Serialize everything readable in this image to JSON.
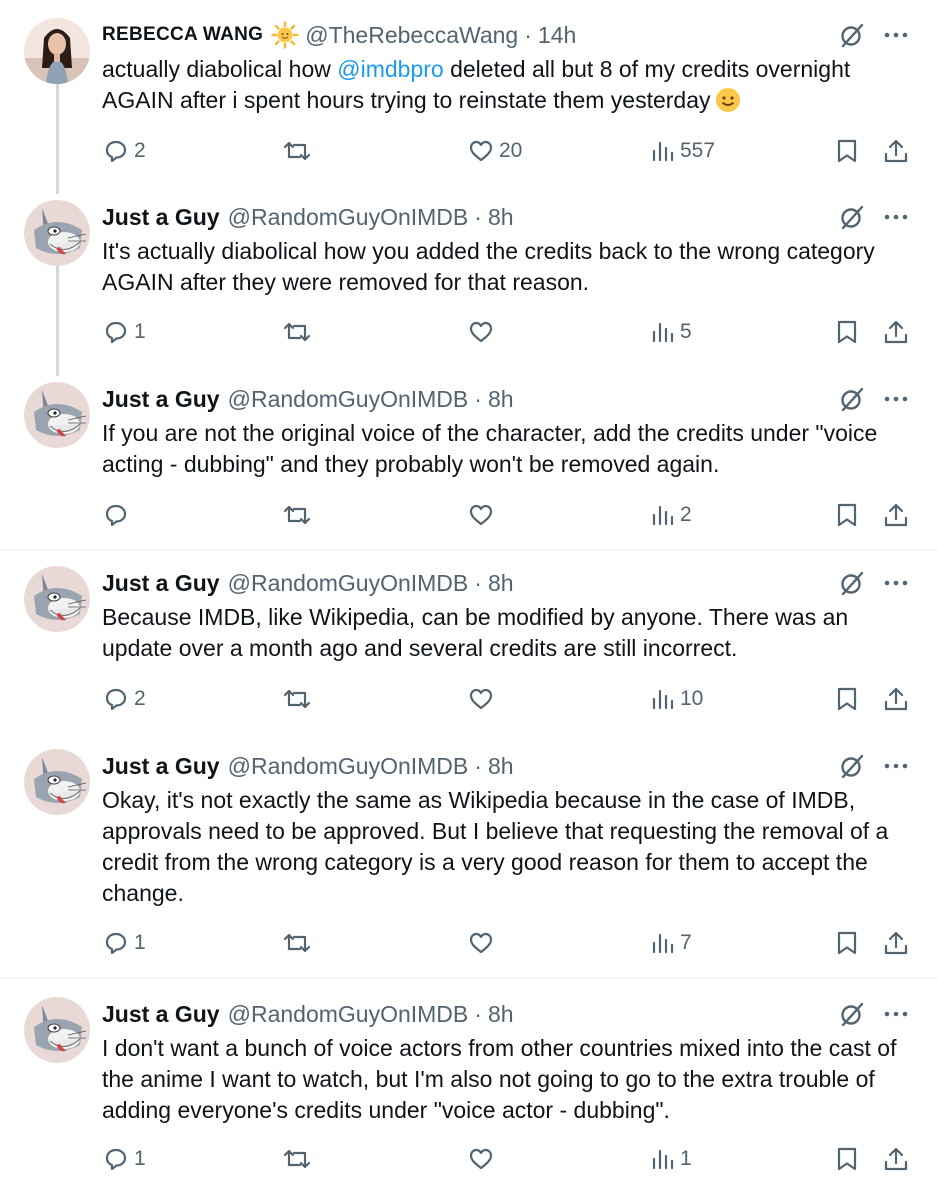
{
  "tweets": [
    {
      "name": "REBECCA WANG",
      "handle": "@TheRebeccaWang",
      "dot": "·",
      "time": "14h",
      "text_before": "actually diabolical how ",
      "mention": "@imdbpro",
      "text_after": " deleted all but 8 of my credits overnight AGAIN after i spent hours trying to reinstate them yesterday",
      "reply_count": "2",
      "retweet_count": "",
      "like_count": "20",
      "view_count": "557",
      "avatar_icon": "woman-photo-avatar"
    },
    {
      "name": "Just a Guy",
      "handle": "@RandomGuyOnIMDB",
      "dot": "·",
      "time": "8h",
      "text": "It's actually diabolical how you added the credits back to the wrong category AGAIN after they were removed for that reason.",
      "reply_count": "1",
      "retweet_count": "",
      "like_count": "",
      "view_count": "5",
      "avatar_icon": "cartoon-rabbit-avatar"
    },
    {
      "name": "Just a Guy",
      "handle": "@RandomGuyOnIMDB",
      "dot": "·",
      "time": "8h",
      "text": "If you are not the original voice of the character, add the credits under \"voice acting - dubbing\" and they probably won't be removed again.",
      "reply_count": "",
      "retweet_count": "",
      "like_count": "",
      "view_count": "2",
      "avatar_icon": "cartoon-rabbit-avatar"
    },
    {
      "name": "Just a Guy",
      "handle": "@RandomGuyOnIMDB",
      "dot": "·",
      "time": "8h",
      "text": "Because IMDB, like Wikipedia, can be modified by anyone. There was an update over a month ago and several credits are still incorrect.",
      "reply_count": "2",
      "retweet_count": "",
      "like_count": "",
      "view_count": "10",
      "avatar_icon": "cartoon-rabbit-avatar"
    },
    {
      "name": "Just a Guy",
      "handle": "@RandomGuyOnIMDB",
      "dot": "·",
      "time": "8h",
      "text": "Okay, it's not exactly the same as Wikipedia because in the case of IMDB, approvals need to be approved. But I believe that requesting the removal of a credit from the wrong category is a very good reason for them to accept the change.",
      "reply_count": "1",
      "retweet_count": "",
      "like_count": "",
      "view_count": "7",
      "avatar_icon": "cartoon-rabbit-avatar"
    },
    {
      "name": "Just a Guy",
      "handle": "@RandomGuyOnIMDB",
      "dot": "·",
      "time": "8h",
      "text": "I don't want a bunch of voice actors from other countries mixed into the cast of the anime I want to watch, but I'm also not going to go to the extra trouble of adding everyone's credits under \"voice actor - dubbing\".",
      "reply_count": "1",
      "retweet_count": "",
      "like_count": "",
      "view_count": "1",
      "avatar_icon": "cartoon-rabbit-avatar"
    }
  ],
  "icons": {
    "grok": "grok-icon",
    "more": "more-icon",
    "reply": "reply-icon",
    "retweet": "retweet-icon",
    "like": "like-icon",
    "views": "views-icon",
    "bookmark": "bookmark-icon",
    "share": "share-icon",
    "verified_emoji": "sun-emoji-icon",
    "smile_emoji": "smile-emoji-icon"
  },
  "colors": {
    "text": "#0f1419",
    "muted": "#536471",
    "link": "#1d9bf0",
    "thread_line": "#cfd9de",
    "separator": "#eff3f4"
  }
}
